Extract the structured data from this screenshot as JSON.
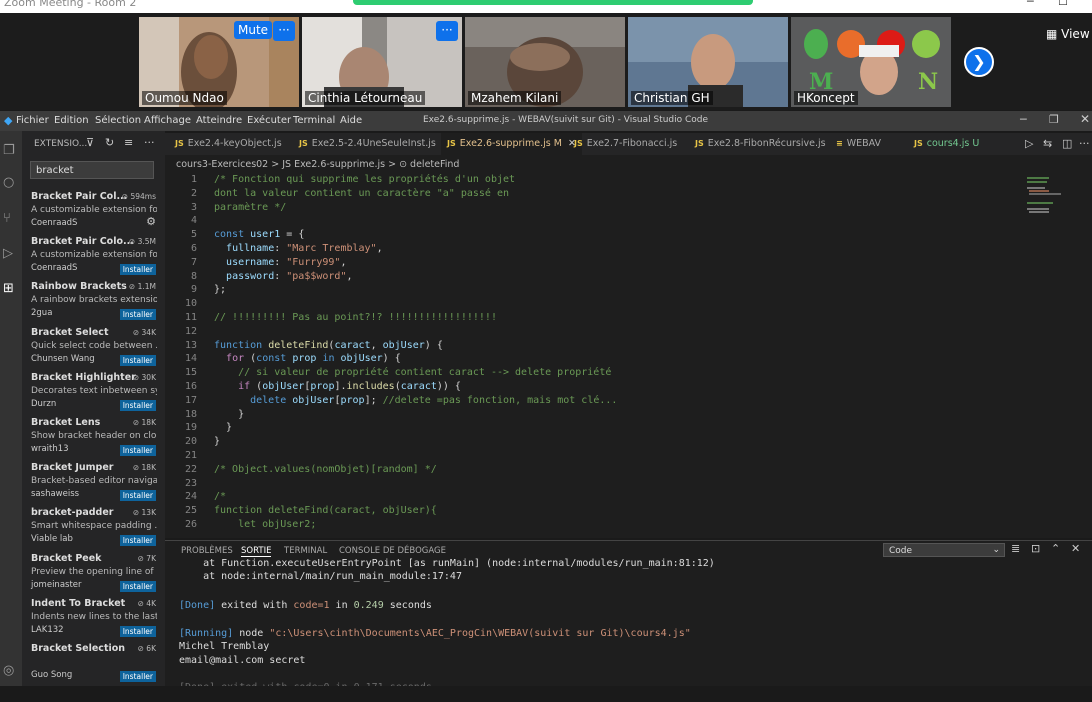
{
  "zoom": {
    "window_title": "Zoom Meeting - Room 2",
    "participants": [
      {
        "name": "Oumou Ndao",
        "bg": "#b59478"
      },
      {
        "name": "Cinthia Létourneau",
        "bg": "#8d8a86"
      },
      {
        "name": "Mzahem Kilani",
        "bg": "#6f6761"
      },
      {
        "name": "Christian GH",
        "bg": "#6f8aa1"
      },
      {
        "name": "HKoncept",
        "bg": "#5a5b5c"
      }
    ],
    "mute_label": "Mute",
    "more_label": "···",
    "view_label": "View"
  },
  "vscode": {
    "menu": [
      "Fichier",
      "Edition",
      "Sélection",
      "Affichage",
      "Atteindre",
      "Exécuter",
      "Terminal",
      "Aide"
    ],
    "title": "Exe2.6-supprime.js - WEBAV(suivit sur Git) - Visual Studio Code",
    "sidebar_title": "EXTENSIO...",
    "search_value": "bracket",
    "extensions": [
      {
        "name": "Bracket Pair Col...",
        "downloads": "594ms",
        "desc": "A customizable extension fo...",
        "author": "CoenraadS",
        "install": ""
      },
      {
        "name": "Bracket Pair Colo...",
        "downloads": "3.5M",
        "desc": "A customizable extension fo...",
        "author": "CoenraadS",
        "install": "Installer"
      },
      {
        "name": "Rainbow Brackets",
        "downloads": "1.1M",
        "desc": "A rainbow brackets extensio...",
        "author": "2gua",
        "install": "Installer"
      },
      {
        "name": "Bracket Select",
        "downloads": "34K",
        "desc": "Quick select code between ...",
        "author": "Chunsen Wang",
        "install": "Installer"
      },
      {
        "name": "Bracket Highlighter",
        "downloads": "30K",
        "desc": "Decorates text inbetween sy...",
        "author": "Durzn",
        "install": "Installer"
      },
      {
        "name": "Bracket Lens",
        "downloads": "18K",
        "desc": "Show bracket header on clo...",
        "author": "wraith13",
        "install": "Installer"
      },
      {
        "name": "Bracket Jumper",
        "downloads": "18K",
        "desc": "Bracket-based editor naviga...",
        "author": "sashaweiss",
        "install": "Installer"
      },
      {
        "name": "bracket-padder",
        "downloads": "13K",
        "desc": "Smart whitespace padding ...",
        "author": "Viable lab",
        "install": "Installer"
      },
      {
        "name": "Bracket Peek",
        "downloads": "7K",
        "desc": "Preview the opening line of ...",
        "author": "jomeinaster",
        "install": "Installer"
      },
      {
        "name": "Indent To Bracket",
        "downloads": "4K",
        "desc": "Indents new lines to the last...",
        "author": "LAK132",
        "install": "Installer"
      },
      {
        "name": "Bracket Selection",
        "downloads": "6K",
        "desc": "",
        "author": "Guo Song",
        "install": "Installer"
      }
    ],
    "tabs": [
      {
        "label": "Exe2.4-keyObject.js",
        "badge": "JS"
      },
      {
        "label": "Exe2.5-2.4UneSeuleInst.js",
        "badge": "JS"
      },
      {
        "label": "Exe2.6-supprime.js M",
        "badge": "JS"
      },
      {
        "label": "Exe2.7-Fibonacci.js",
        "badge": "JS"
      },
      {
        "label": "Exe2.8-FibonRécursive.js",
        "badge": "JS"
      },
      {
        "label": "WEBAV",
        "badge": "≡"
      },
      {
        "label": "cours4.js U",
        "badge": "JS"
      }
    ],
    "breadcrumb": "cours3-Exercices02 > JS Exe2.6-supprime.js > ⊙ deleteFind",
    "panel_tabs": [
      "PROBLÈMES",
      "SORTIE",
      "TERMINAL",
      "CONSOLE DE DÉBOGAGE"
    ],
    "output_channel": "Code",
    "output": {
      "l1": "    at Function.executeUserEntryPoint [as runMain] (node:internal/modules/run_main:81:12)",
      "l2": "    at node:internal/main/run_main_module:17:47",
      "done1_a": "[Done]",
      "done1_b": " exited with ",
      "done1_c": "code=1",
      "done1_d": " in ",
      "done1_e": "0.249",
      "done1_f": " seconds",
      "run_a": "[Running]",
      "run_b": " node ",
      "run_c": "\"c:\\Users\\cinth\\Documents\\AEC_ProgCin\\WEBAV(suivit sur Git)\\cours4.js\"",
      "l5": "Michel Tremblay",
      "l6": "email@mail.com secret",
      "l7": "[Done] exited with code=0 in 0.171 seconds"
    }
  }
}
